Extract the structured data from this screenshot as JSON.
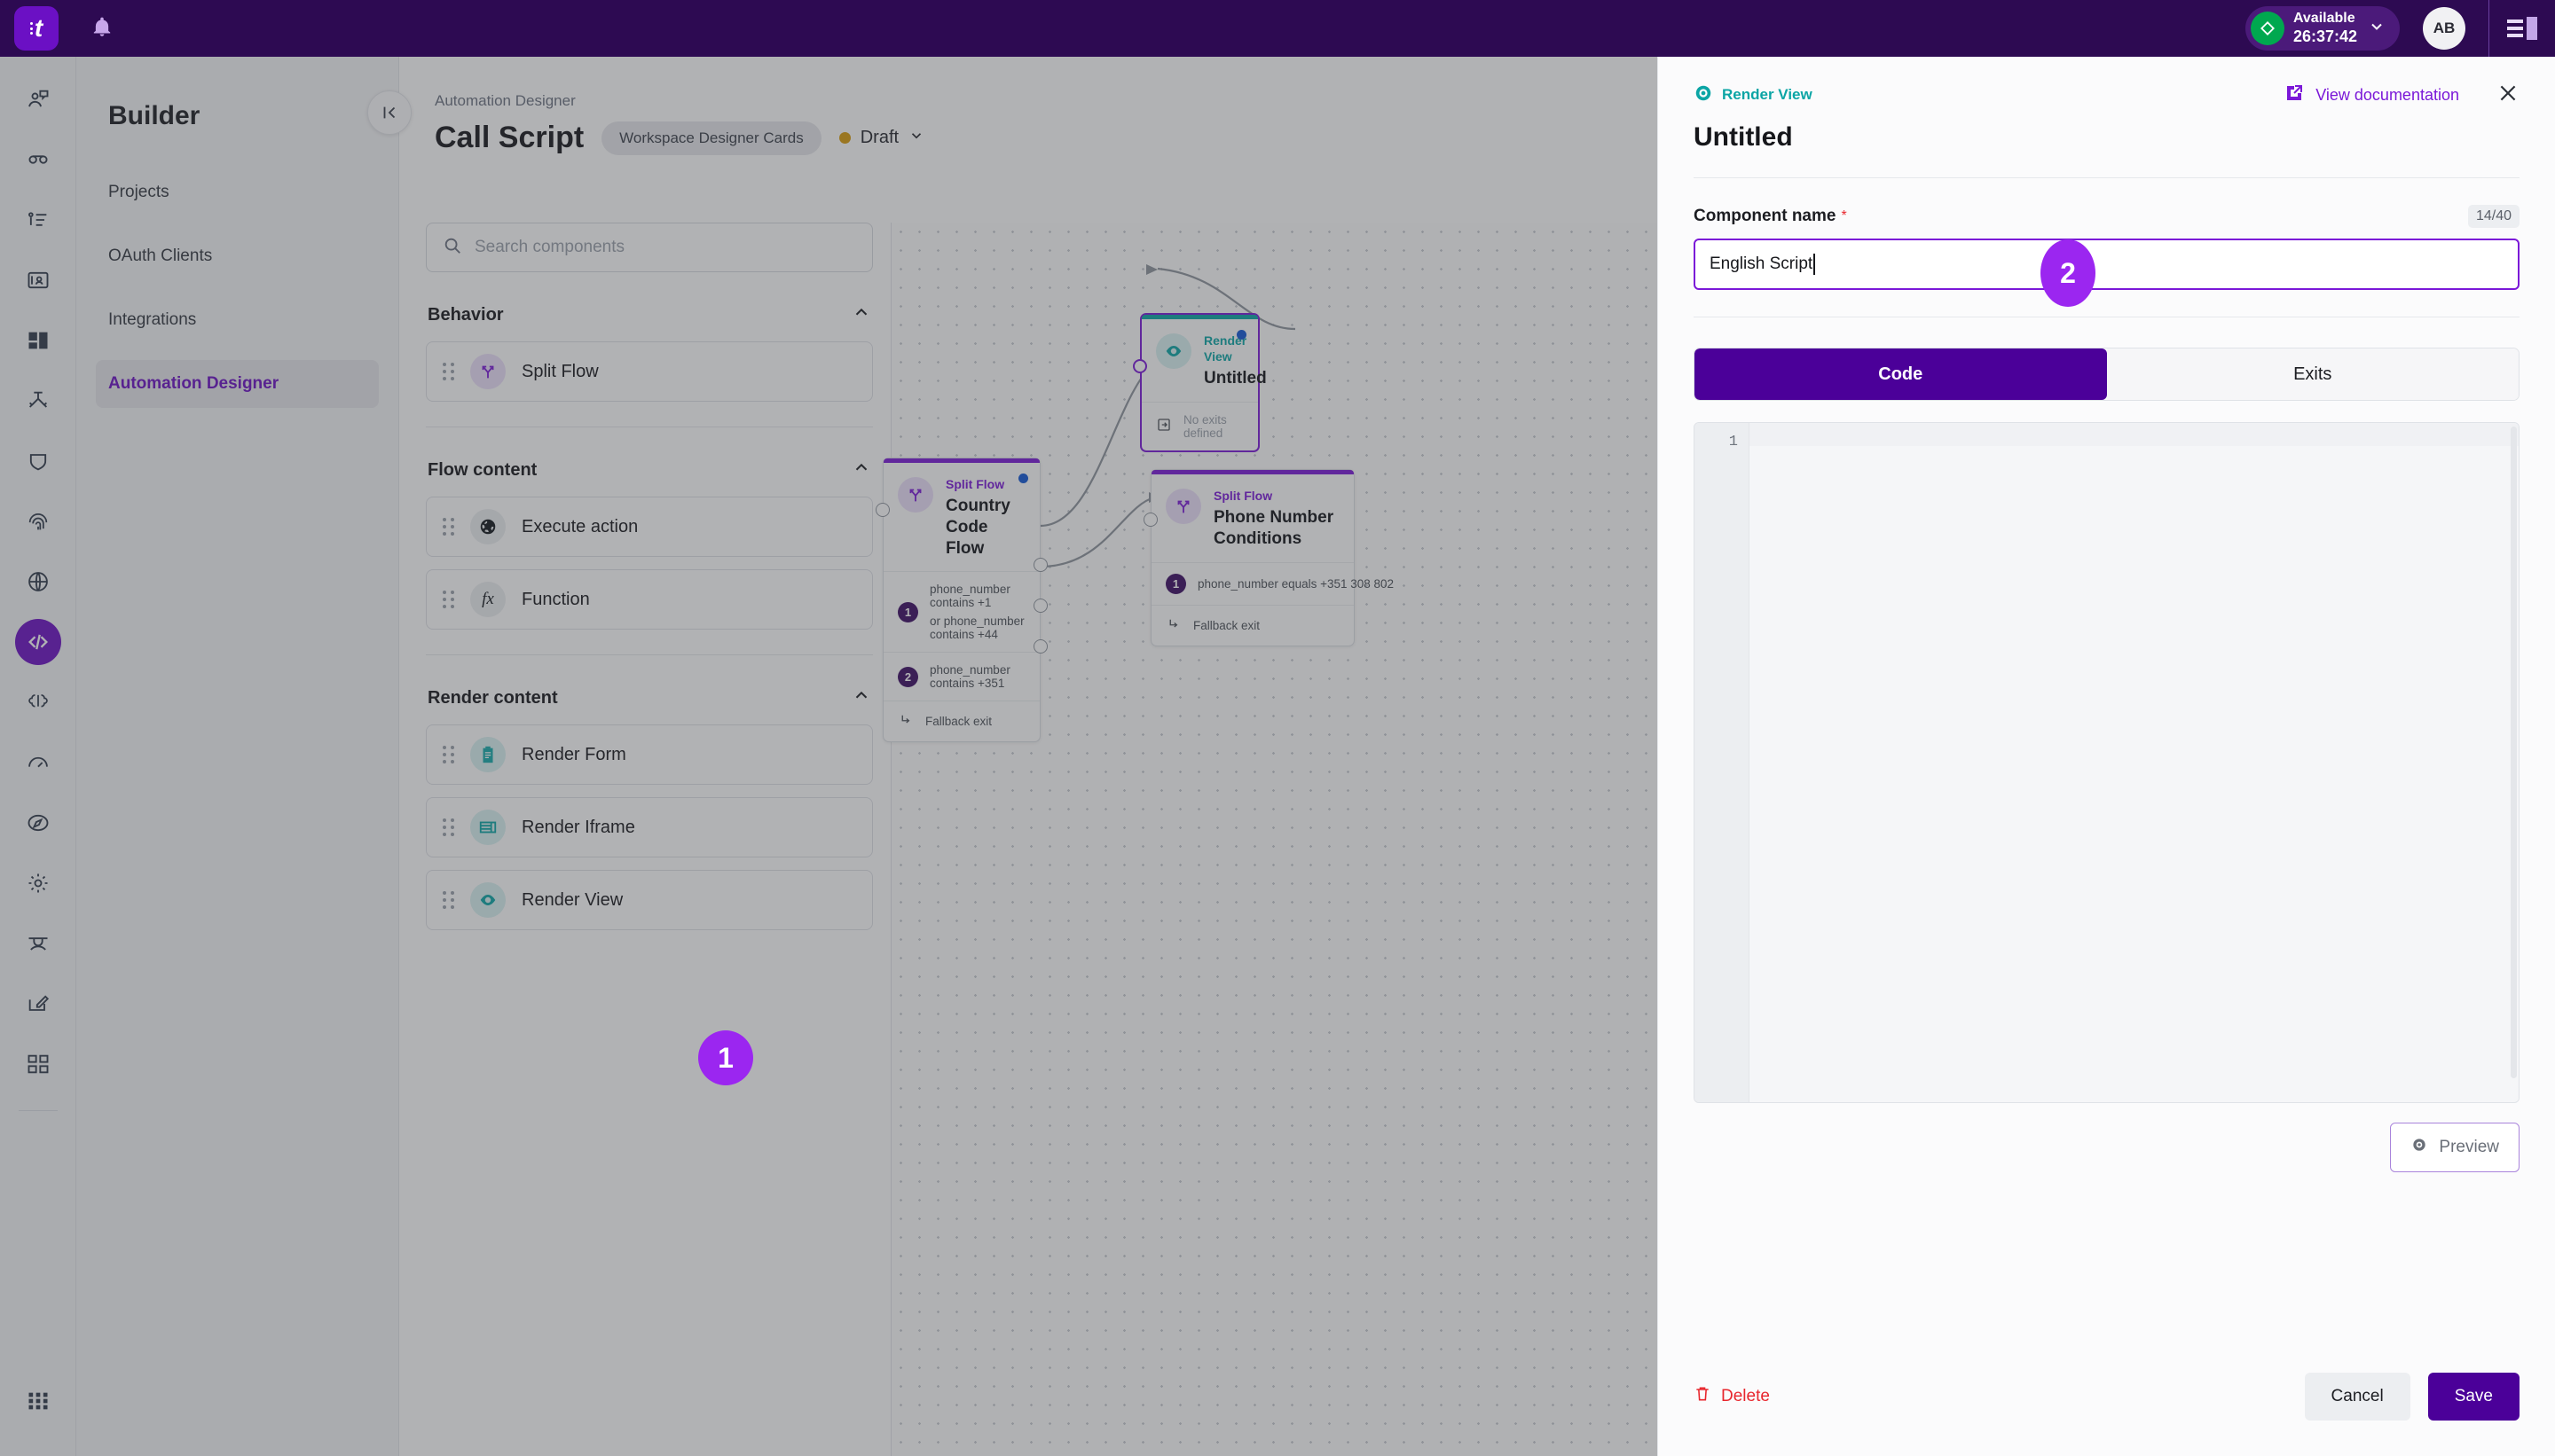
{
  "topbar": {
    "logo_icon": "app-logo-icon",
    "bell_icon": "notification-bell-icon",
    "status": {
      "label": "Available",
      "timer": "26:37:42",
      "icon": "availability-diamond-icon",
      "color": "#00a84f"
    },
    "avatar_initials": "AB",
    "menu_icon": "hamburger-menu-icon"
  },
  "rail": {
    "items": [
      {
        "name": "agent-assist-icon"
      },
      {
        "name": "voice-call-icon"
      },
      {
        "name": "queue-list-icon"
      },
      {
        "name": "contacts-icon"
      },
      {
        "name": "dashboard-layout-icon"
      },
      {
        "name": "routing-flow-icon"
      },
      {
        "name": "shield-icon"
      },
      {
        "name": "fingerprint-icon"
      },
      {
        "name": "globe-icon"
      },
      {
        "name": "code-builder-icon",
        "active": true
      },
      {
        "name": "brain-ai-icon"
      },
      {
        "name": "speedometer-icon"
      },
      {
        "name": "compass-icon"
      },
      {
        "name": "gear-settings-icon"
      },
      {
        "name": "training-icon"
      },
      {
        "name": "compose-edit-icon"
      },
      {
        "name": "apps-grid-icon"
      }
    ],
    "bottom_icon": "app-switcher-icon"
  },
  "builder": {
    "title": "Builder",
    "items": [
      {
        "label": "Projects",
        "active": false
      },
      {
        "label": "OAuth Clients",
        "active": false
      },
      {
        "label": "Integrations",
        "active": false
      },
      {
        "label": "Automation Designer",
        "active": true
      }
    ],
    "collapse_icon": "collapse-panel-icon"
  },
  "main": {
    "breadcrumb": "Automation Designer",
    "page_title": "Call Script",
    "workspace_chip": "Workspace Designer Cards",
    "state": {
      "label": "Draft",
      "color": "#d99c0b",
      "chevron_icon": "chevron-down-icon"
    }
  },
  "palette": {
    "search": {
      "placeholder": "Search components",
      "value": "",
      "icon": "search-icon"
    },
    "groups": [
      {
        "title": "Behavior",
        "chevron_icon": "chevron-up-icon",
        "items": [
          {
            "label": "Split Flow",
            "icon": "split-flow-icon",
            "tone": "purple"
          }
        ]
      },
      {
        "title": "Flow content",
        "chevron_icon": "chevron-up-icon",
        "items": [
          {
            "label": "Execute action",
            "icon": "globe-action-icon",
            "tone": "grey"
          },
          {
            "label": "Function",
            "icon": "function-fx-icon",
            "tone": "grey"
          }
        ]
      },
      {
        "title": "Render content",
        "chevron_icon": "chevron-up-icon",
        "items": [
          {
            "label": "Render Form",
            "icon": "clipboard-form-icon",
            "tone": "teal"
          },
          {
            "label": "Render Iframe",
            "icon": "iframe-layout-icon",
            "tone": "teal"
          },
          {
            "label": "Render View",
            "icon": "eye-view-icon",
            "tone": "teal"
          }
        ]
      }
    ]
  },
  "canvas": {
    "nodes": [
      {
        "id": "untitled",
        "kind": "Render View",
        "kind_color": "#0ba5a5",
        "title": "Untitled",
        "icon": "eye-view-icon",
        "selected": true,
        "exits": [
          {
            "label": "No exits defined",
            "type": "none",
            "icon": "no-exit-icon"
          }
        ]
      },
      {
        "id": "country-code-flow",
        "kind": "Split Flow",
        "kind_color": "#7b18d8",
        "title": "Country Code Flow",
        "icon": "split-flow-icon",
        "selected": false,
        "exits": [
          {
            "num": "1",
            "label": "phone_number contains +1",
            "label2": "or phone_number contains +44"
          },
          {
            "num": "2",
            "label": "phone_number contains +351"
          },
          {
            "label": "Fallback exit",
            "type": "fallback",
            "icon": "fallback-exit-icon"
          }
        ]
      },
      {
        "id": "phone-number-conditions",
        "kind": "Split Flow",
        "kind_color": "#7b18d8",
        "title": "Phone Number Conditions",
        "icon": "split-flow-icon",
        "selected": false,
        "exits": [
          {
            "num": "1",
            "label": "phone_number equals +351 308 802"
          },
          {
            "label": "Fallback exit",
            "type": "fallback",
            "icon": "fallback-exit-icon"
          }
        ]
      }
    ]
  },
  "drawer": {
    "kind_tag": "Render View",
    "kind_icon": "eye-view-icon",
    "doc_link": "View documentation",
    "doc_icon": "external-link-icon",
    "close_icon": "close-icon",
    "title": "Untitled",
    "field": {
      "label": "Component name",
      "required_mark": "*",
      "counter": "14/40",
      "value": "English Script",
      "placeholder": ""
    },
    "tabs": [
      {
        "label": "Code",
        "active": true
      },
      {
        "label": "Exits",
        "active": false
      }
    ],
    "editor": {
      "line_numbers": [
        "1"
      ],
      "content": ""
    },
    "preview_button": {
      "label": "Preview",
      "icon": "eye-preview-icon"
    },
    "delete_button": {
      "label": "Delete",
      "icon": "trash-icon"
    },
    "cancel_button": "Cancel",
    "save_button": "Save"
  },
  "steps": [
    {
      "id": "1",
      "label": "1"
    },
    {
      "id": "2",
      "label": "2"
    }
  ],
  "colors": {
    "brand_purple": "#4b0099",
    "accent_purple": "#7b18d8",
    "step_badge": "#9b26f0",
    "teal": "#0ba5a5",
    "danger": "#e8262d",
    "draft_amber": "#d99c0b",
    "available_green": "#00a84f"
  }
}
